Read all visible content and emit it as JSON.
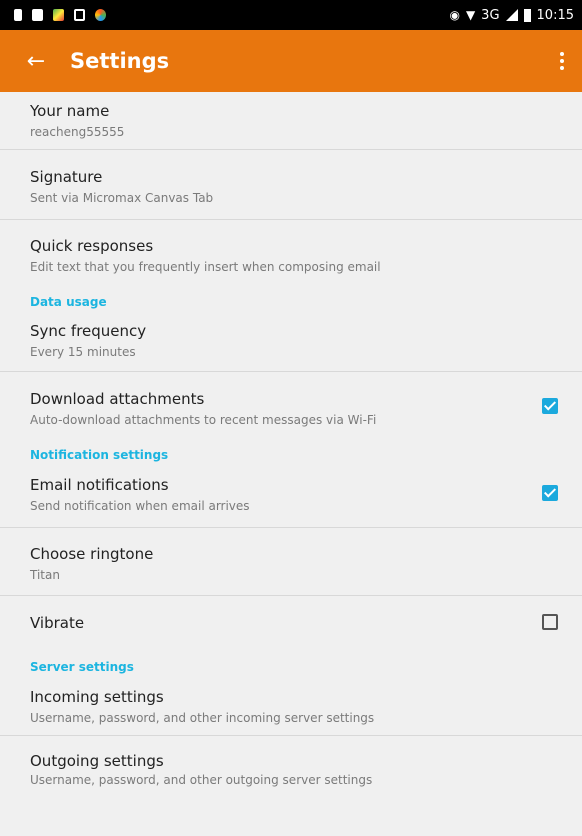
{
  "status_bar": {
    "network": "3G",
    "time": "10:15"
  },
  "app_bar": {
    "back_icon": "arrow-back-icon",
    "title": "Settings",
    "menu_icon": "more-vert-icon"
  },
  "settings": {
    "your_name": {
      "title": "Your name",
      "value": "reacheng55555"
    },
    "signature": {
      "title": "Signature",
      "value": "Sent via Micromax Canvas Tab"
    },
    "quick_responses": {
      "title": "Quick responses",
      "summary": "Edit text that you frequently insert when composing email"
    },
    "data_usage_header": "Data usage",
    "sync_frequency": {
      "title": "Sync frequency",
      "value": "Every 15 minutes"
    },
    "download_attachments": {
      "title": "Download attachments",
      "summary": "Auto-download attachments to recent messages via Wi-Fi",
      "checked": true
    },
    "notification_header": "Notification settings",
    "email_notifications": {
      "title": "Email notifications",
      "summary": "Send notification when email arrives",
      "checked": true
    },
    "choose_ringtone": {
      "title": "Choose ringtone",
      "value": "Titan"
    },
    "vibrate": {
      "title": "Vibrate",
      "checked": false
    },
    "server_header": "Server settings",
    "incoming_settings": {
      "title": "Incoming settings",
      "summary": "Username, password, and other incoming server settings"
    },
    "outgoing_settings": {
      "title": "Outgoing settings",
      "summary": "Username, password, and other outgoing server settings"
    }
  },
  "colors": {
    "accent": "#e8760e",
    "section_header": "#1cb5e0",
    "checkbox_checked": "#1ba9dd"
  }
}
